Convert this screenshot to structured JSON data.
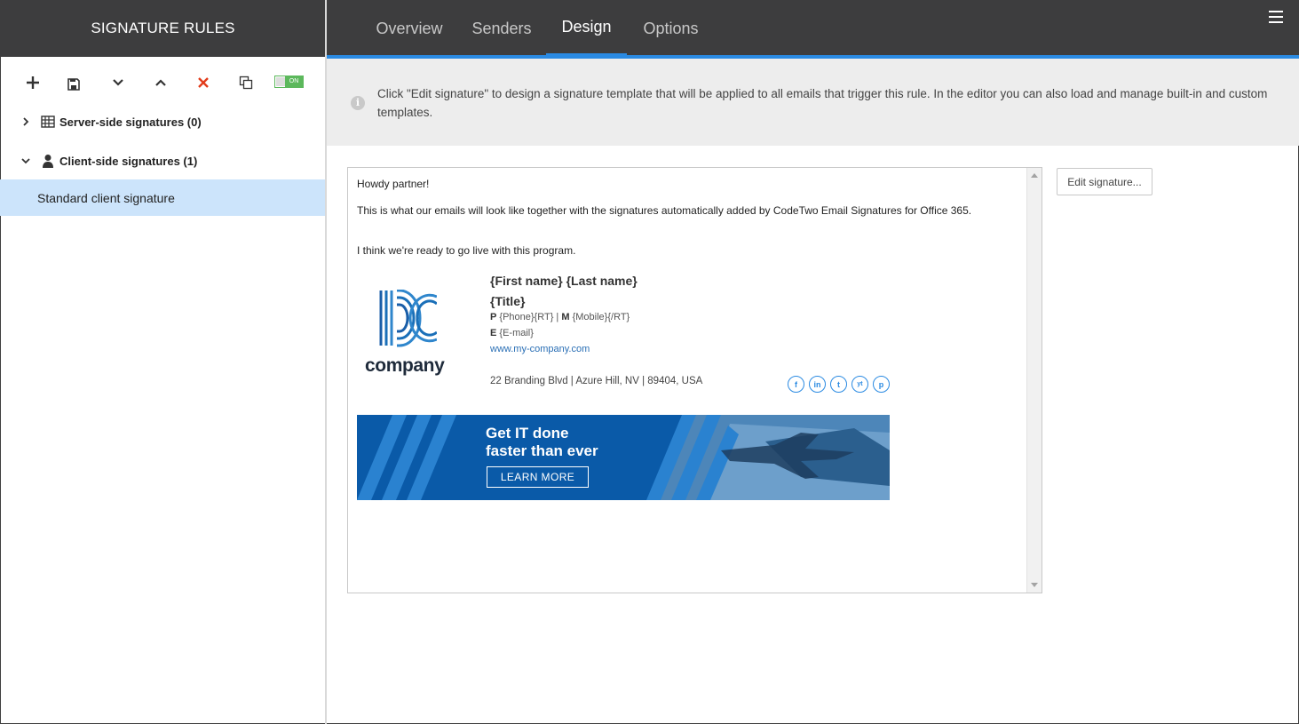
{
  "sidebar": {
    "title": "SIGNATURE RULES",
    "toolbar": {
      "add": "add",
      "save": "save",
      "move_down": "move down",
      "move_up": "move up",
      "delete": "delete",
      "duplicate": "duplicate",
      "toggle_label": "ON"
    },
    "tree": [
      {
        "label": "Server-side signatures (0)",
        "icon": "server-icon",
        "expanded": false
      },
      {
        "label": "Client-side signatures (1)",
        "icon": "user-icon",
        "expanded": true
      }
    ],
    "selected_item": "Standard client signature"
  },
  "tabs": [
    {
      "label": "Overview",
      "active": false
    },
    {
      "label": "Senders",
      "active": false
    },
    {
      "label": "Design",
      "active": true
    },
    {
      "label": "Options",
      "active": false
    }
  ],
  "info": {
    "icon": "i",
    "text": "Click \"Edit signature\" to design a signature template that will be applied to all emails that trigger this rule. In the editor you can also load and manage built-in and custom templates."
  },
  "preview": {
    "greeting": "Howdy partner!",
    "body1": "This is what our emails will look like together with the signatures automatically added by CodeTwo Email Signatures for Office 365.",
    "body2": "I think we're ready to go live with this program.",
    "logo_text": "company",
    "signature": {
      "name": "{First name} {Last name}",
      "title": "{Title}",
      "phone_label": "P",
      "phone_value": "{Phone}{RT}",
      "mobile_sep": " | ",
      "mobile_label": "M",
      "mobile_value": "{Mobile}{/RT}",
      "email_label": "E",
      "email_value": "{E-mail}",
      "website": "www.my-company.com",
      "address": "22 Branding Blvd | Azure Hill, NV | 89404, USA",
      "social": [
        "f",
        "in",
        "t",
        "yt",
        "p"
      ]
    },
    "banner": {
      "line1": "Get IT done",
      "line2": "faster than ever",
      "button": "LEARN MORE"
    }
  },
  "edit_button": "Edit signature...",
  "colors": {
    "header_bg": "#3d3d3e",
    "accent": "#2a8ae2",
    "selected_bg": "#cce4fb",
    "toggle_green": "#5cb85c",
    "delete_red": "#e23c1b"
  }
}
